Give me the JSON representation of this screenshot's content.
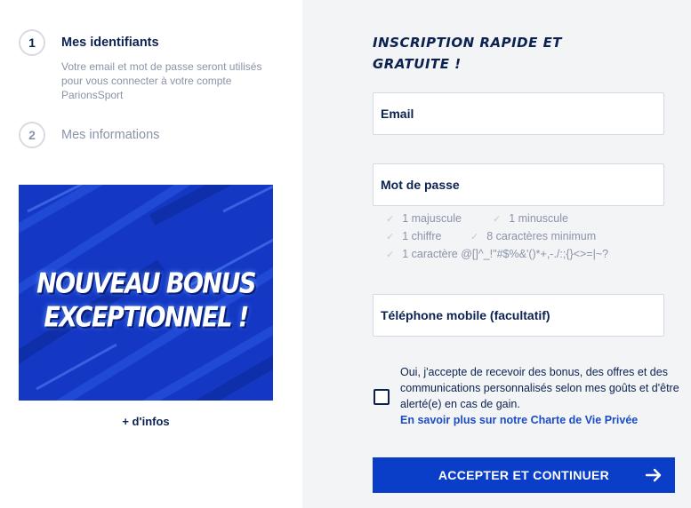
{
  "steps": [
    {
      "number": "1",
      "title": "Mes identifiants",
      "description": "Votre email et mot de passe seront utilisés pour vous connecter à votre compte ParionsSport"
    },
    {
      "number": "2",
      "title": "Mes informations"
    }
  ],
  "banner": {
    "line1": "NOUVEAU BONUS",
    "line2": "EXCEPTIONNEL !"
  },
  "more_info": "+ d'infos",
  "form": {
    "title": "INSCRIPTION RAPIDE ET GRATUITE !",
    "email_label": "Email",
    "password_label": "Mot de passe",
    "password_rules": [
      "1 majuscule",
      "1 minuscule",
      "1 chiffre",
      "8 caractères minimum",
      "1 caractère @[]^_!\"#$%&'()*+,-./:;{}<>=|~?"
    ],
    "phone_label": "Téléphone mobile (facultatif)",
    "consent": "Oui, j'accepte de recevoir des bonus, des offres et des communications personnalisés selon mes goûts et d'être alerté(e) en cas de gain.",
    "privacy_link": "En savoir plus sur notre Charte de Vie Privée",
    "submit_label": "ACCEPTER ET CONTINUER"
  },
  "colors": {
    "navy": "#0b2250",
    "primary_blue": "#0a3ec9",
    "banner_blue": "#1438c4",
    "muted_gray": "#8a93a8",
    "right_bg": "#f3f4f6"
  },
  "icons": {
    "rule_check": "check-icon",
    "submit_arrow": "arrow-right-icon"
  }
}
